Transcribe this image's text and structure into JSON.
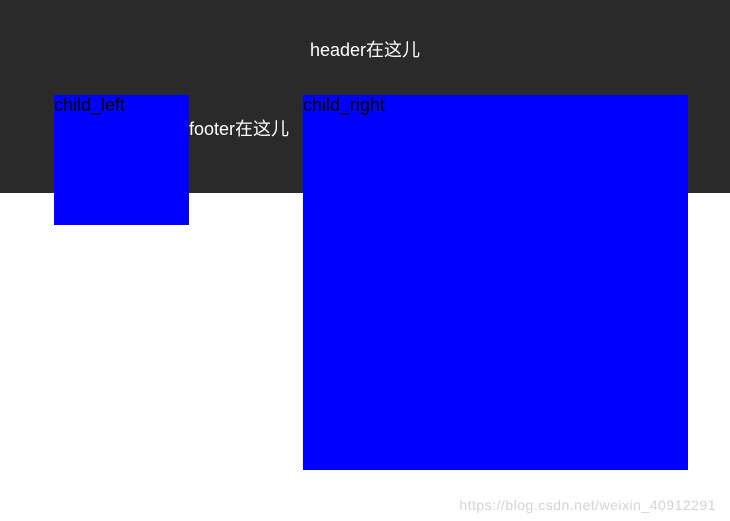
{
  "header": {
    "text": "header在这儿"
  },
  "footer": {
    "text": "footer在这儿"
  },
  "children": {
    "left": {
      "label": "child_left"
    },
    "right": {
      "label": "child_right"
    }
  },
  "watermark": "https://blog.csdn.net/weixin_40912291"
}
